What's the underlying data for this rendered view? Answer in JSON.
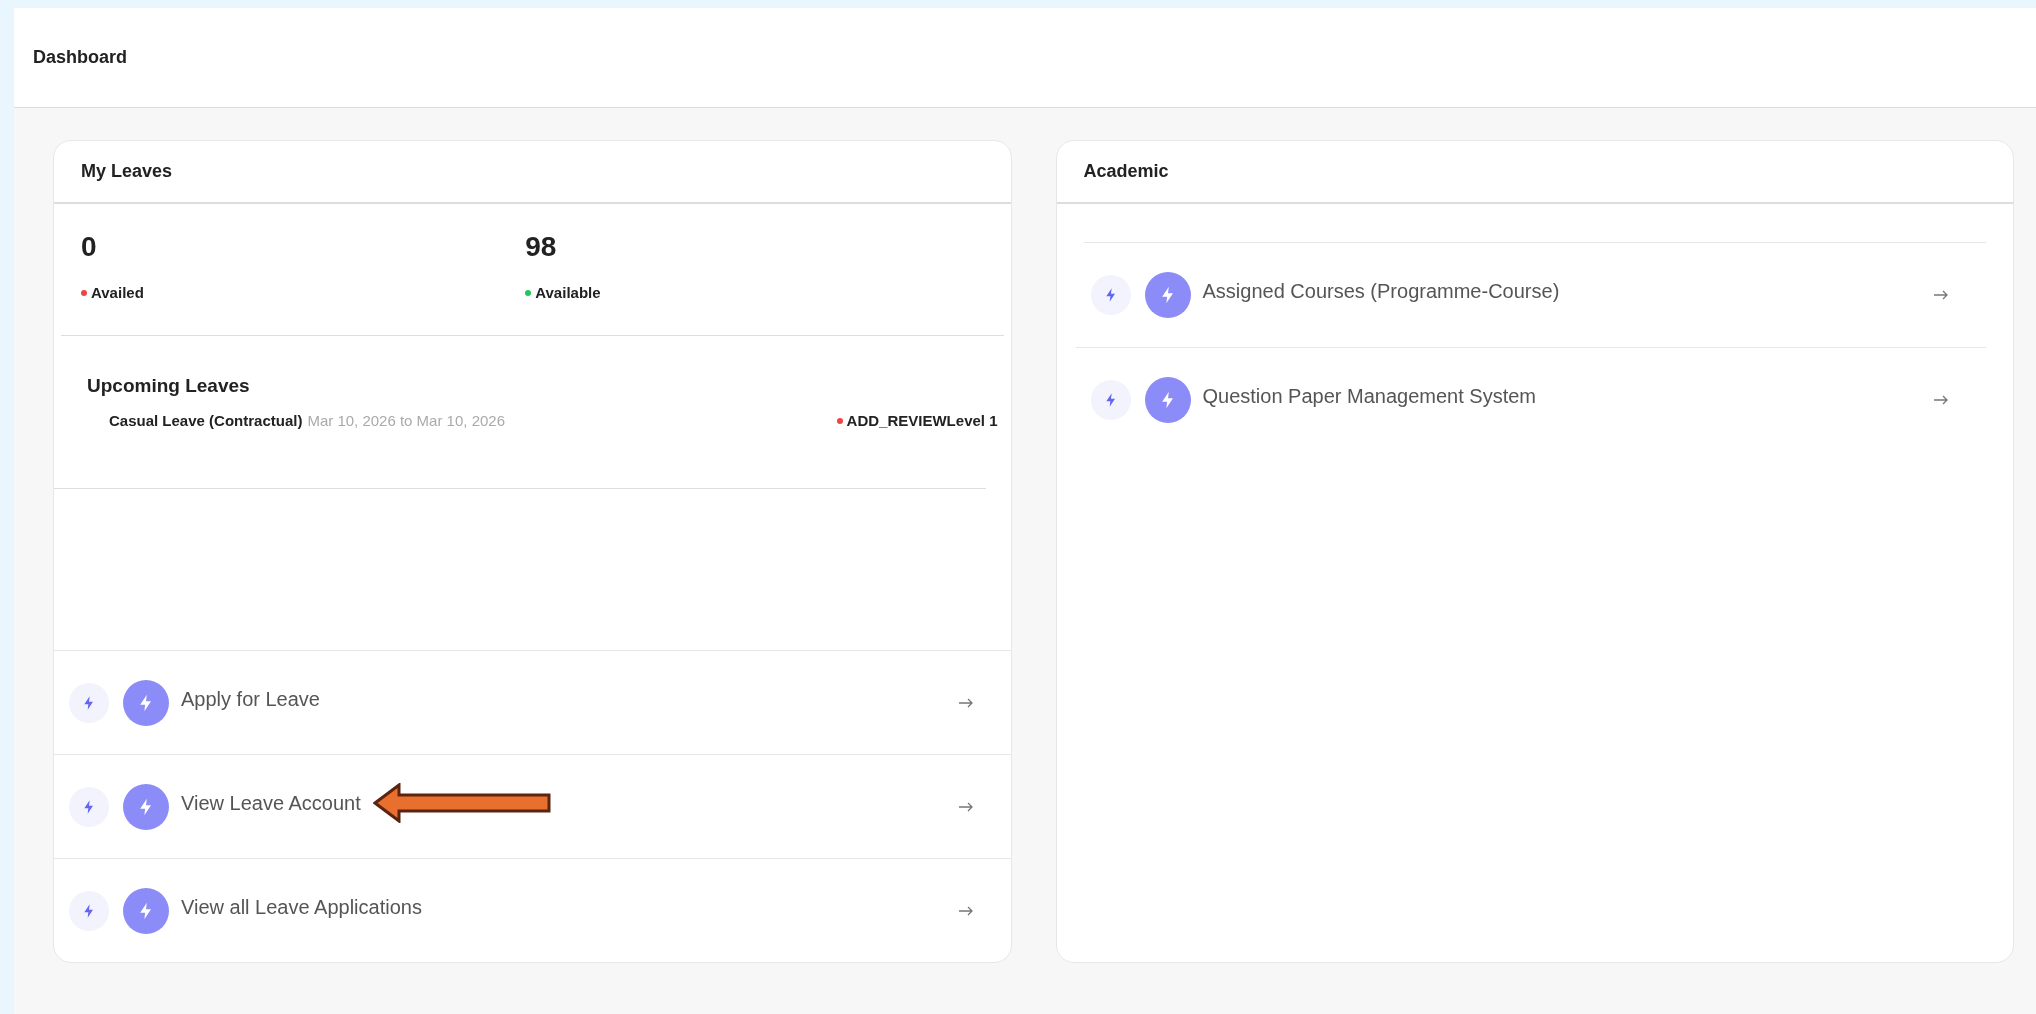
{
  "header": {
    "title": "Dashboard"
  },
  "my_leaves": {
    "title": "My Leaves",
    "stats": [
      {
        "value": "0",
        "label": "Availed",
        "color": "#ef4444"
      },
      {
        "value": "98",
        "label": "Available",
        "color": "#22c55e"
      }
    ],
    "upcoming": {
      "title": "Upcoming Leaves",
      "items": [
        {
          "type": "Casual Leave (Contractual)",
          "dates": "Mar 10, 2026 to Mar 10, 2026",
          "status": "ADD_REVIEWLevel 1",
          "color": "#ef4444"
        }
      ]
    },
    "links": [
      {
        "label": "Apply for Leave",
        "annotated": false
      },
      {
        "label": "View Leave Account",
        "annotated": true
      },
      {
        "label": "View all Leave Applications",
        "annotated": false
      }
    ]
  },
  "academic": {
    "title": "Academic",
    "links": [
      {
        "label": "Assigned Courses (Programme-Course)"
      },
      {
        "label": "Question Paper Management System"
      }
    ]
  }
}
